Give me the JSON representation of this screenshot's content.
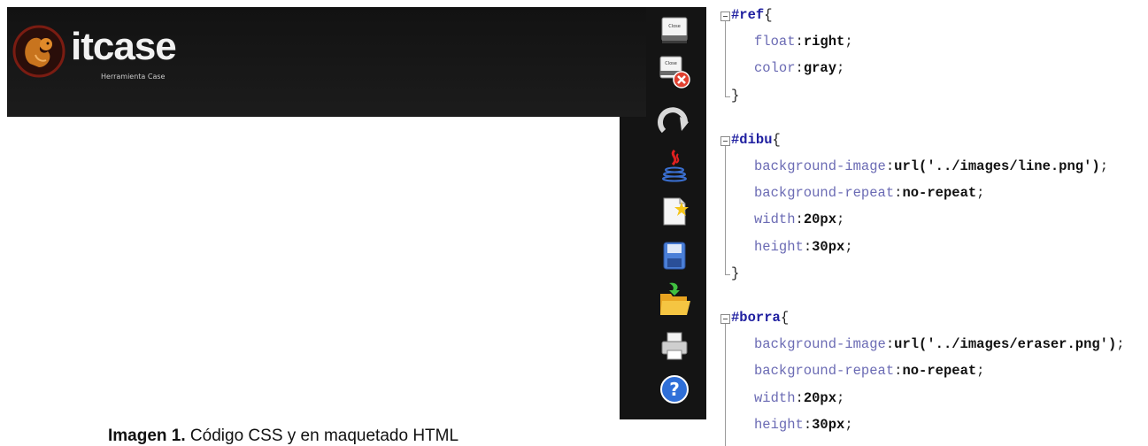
{
  "app": {
    "logo_text": "itcase",
    "logo_subtitle": "Herramienta Case",
    "toolbar": [
      {
        "name": "close-file-button",
        "label": "Close"
      },
      {
        "name": "close-all-button",
        "label": "Close"
      },
      {
        "name": "redo-button",
        "label": ""
      },
      {
        "name": "java-button",
        "label": ""
      },
      {
        "name": "new-file-button",
        "label": ""
      },
      {
        "name": "save-button",
        "label": ""
      },
      {
        "name": "open-folder-button",
        "label": ""
      },
      {
        "name": "print-button",
        "label": ""
      },
      {
        "name": "help-button",
        "label": ""
      }
    ]
  },
  "caption": {
    "bold": "Imagen 1.",
    "text": " Código CSS y  en maquetado HTML"
  },
  "code": {
    "lines": [
      {
        "sel": "#ref",
        "brace": "{"
      },
      {
        "prop": "float",
        "val": "right"
      },
      {
        "prop": "color",
        "val": "gray"
      },
      {
        "close": "}"
      },
      {
        "sel": "#dibu",
        "brace": "{"
      },
      {
        "prop": "background-image",
        "val": "url('../images/line.png')"
      },
      {
        "prop": "background-repeat",
        "val": "no-repeat"
      },
      {
        "prop": "width",
        "val": "20px"
      },
      {
        "prop": "height",
        "val": "30px"
      },
      {
        "close": "}"
      },
      {
        "sel": "#borra",
        "brace": "{"
      },
      {
        "prop": "background-image",
        "val": "url('../images/eraser.png')"
      },
      {
        "prop": "background-repeat",
        "val": "no-repeat"
      },
      {
        "prop": "width",
        "val": "20px"
      },
      {
        "prop": "height",
        "val": "30px"
      }
    ]
  }
}
